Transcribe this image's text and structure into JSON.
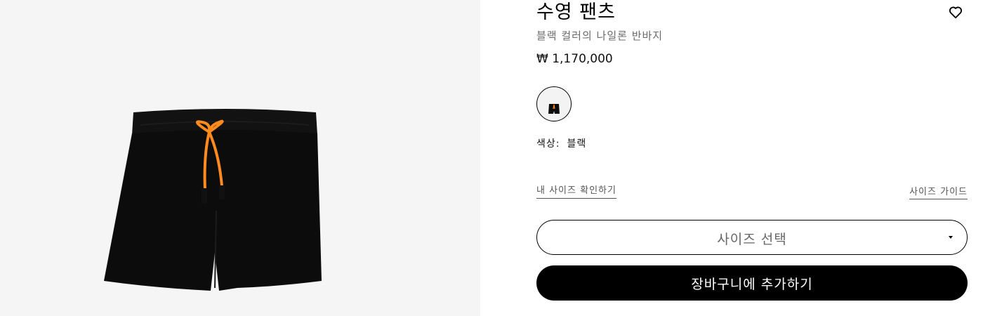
{
  "product": {
    "title": "수영 팬츠",
    "subtitle": "블랙 컬러의 나일론 반바지",
    "price": "₩ 1,170,000",
    "color_label": "색상:",
    "color_value": "블랙",
    "size_check_link": "내 사이즈 확인하기",
    "size_guide_link": "사이즈 가이드",
    "size_select_placeholder": "사이즈 선택",
    "add_to_cart": "장바구니에 추가하기"
  },
  "icons": {
    "wishlist": "heart-icon",
    "dropdown": "caret-down-icon"
  },
  "colors": {
    "image_background": "#f5f5f5",
    "shorts": "#0c0c0c",
    "drawstring": "#ff8a1e",
    "button_bg": "#000000",
    "button_text": "#ffffff"
  }
}
